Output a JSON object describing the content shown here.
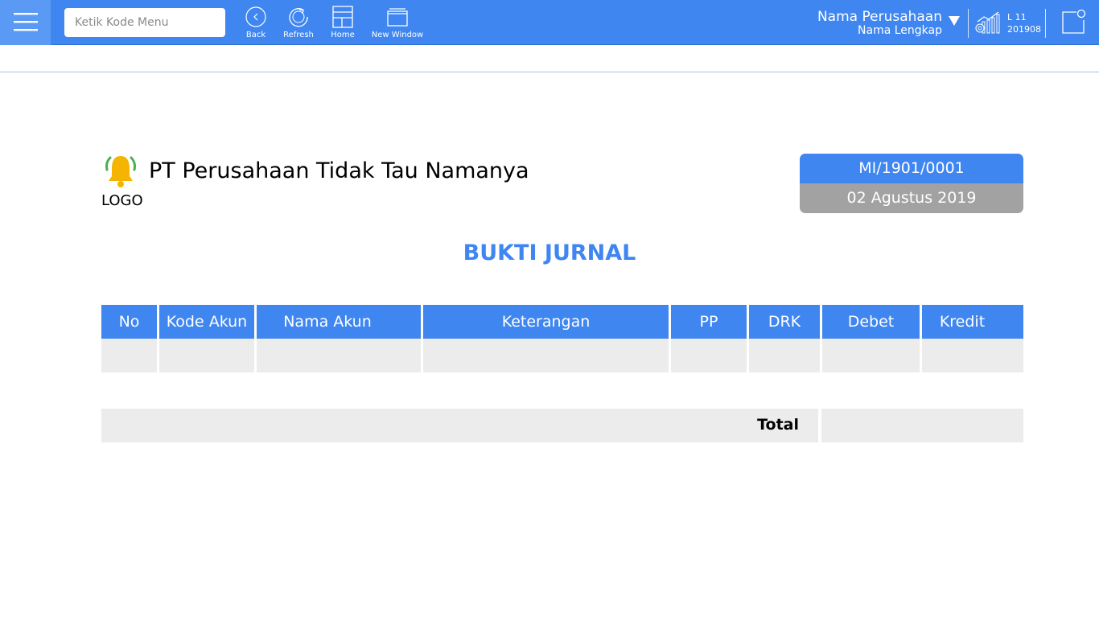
{
  "topbar": {
    "search_placeholder": "Ketik Kode Menu",
    "tools": {
      "back": "Back",
      "refresh": "Refresh",
      "home": "Home",
      "new_window": "New Window"
    },
    "company_name": "Nama Perusahaan",
    "company_full": "Nama Lengkap",
    "level": "L 11",
    "period": "201908",
    "accent_color": "#3f86f0"
  },
  "document": {
    "company_title": "PT Perusahaan Tidak Tau Namanya",
    "logo_label": "LOGO",
    "doc_number": "MI/1901/0001",
    "doc_date": "02 Agustus 2019",
    "title": "BUKTI JURNAL",
    "columns": [
      "No",
      "Kode Akun",
      "Nama Akun",
      "Keterangan",
      "PP",
      "DRK",
      "Debet",
      "Kredit"
    ],
    "rows": [
      [
        "",
        "",
        "",
        "",
        "",
        "",
        "",
        ""
      ]
    ],
    "total_label": "Total",
    "total_value": ""
  }
}
